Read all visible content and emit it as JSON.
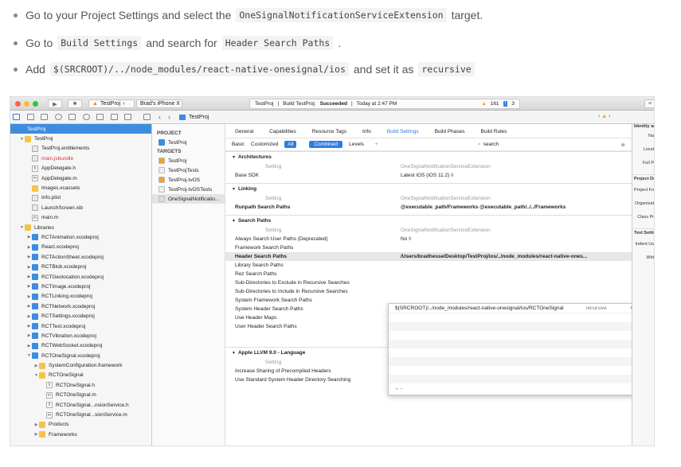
{
  "steps": [
    {
      "pre": "Go to your Project Settings and select the",
      "code": "OneSignalNotificationServiceExtension",
      "post": "target."
    },
    {
      "pre": "Go to",
      "code": "Build Settings",
      "mid": "and search for",
      "code2": "Header Search Paths",
      "post": "."
    },
    {
      "pre": "Add",
      "code": "$(SRCROOT)/../node_modules/react-native-onesignal/ios",
      "mid": "and set it as",
      "code2": "recursive",
      "post": ""
    }
  ],
  "xcode": {
    "scheme_target": "TestProj",
    "device": "Brad's iPhone X",
    "status_project": "TestProj",
    "status_prefix": "Build TestProj:",
    "status_result": "Succeeded",
    "status_time": "Today at 2:47 PM",
    "warnings": "161",
    "errors": "3",
    "breadcrumb": "TestProj",
    "navigator": [
      {
        "label": "TestProj",
        "indent": 0,
        "icon": "proj",
        "open": true,
        "selected": true
      },
      {
        "label": "TestProj",
        "indent": 1,
        "icon": "folder",
        "open": true
      },
      {
        "label": "TestProj.entitlements",
        "indent": 2,
        "icon": "file"
      },
      {
        "label": "main.jsbundle",
        "indent": 2,
        "icon": "file",
        "red": true
      },
      {
        "label": "AppDelegate.h",
        "indent": 2,
        "icon": "h"
      },
      {
        "label": "AppDelegate.m",
        "indent": 2,
        "icon": "m"
      },
      {
        "label": "Images.xcassets",
        "indent": 2,
        "icon": "folder"
      },
      {
        "label": "Info.plist",
        "indent": 2,
        "icon": "file"
      },
      {
        "label": "LaunchScreen.xib",
        "indent": 2,
        "icon": "file"
      },
      {
        "label": "main.m",
        "indent": 2,
        "icon": "m"
      },
      {
        "label": "Libraries",
        "indent": 1,
        "icon": "folder",
        "open": true
      },
      {
        "label": "RCTAnimation.xcodeproj",
        "indent": 2,
        "icon": "proj",
        "closed": true
      },
      {
        "label": "React.xcodeproj",
        "indent": 2,
        "icon": "proj",
        "closed": true
      },
      {
        "label": "RCTActionSheet.xcodeproj",
        "indent": 2,
        "icon": "proj",
        "closed": true
      },
      {
        "label": "RCTBlob.xcodeproj",
        "indent": 2,
        "icon": "proj",
        "closed": true
      },
      {
        "label": "RCTGeolocation.xcodeproj",
        "indent": 2,
        "icon": "proj",
        "closed": true
      },
      {
        "label": "RCTImage.xcodeproj",
        "indent": 2,
        "icon": "proj",
        "closed": true
      },
      {
        "label": "RCTLinking.xcodeproj",
        "indent": 2,
        "icon": "proj",
        "closed": true
      },
      {
        "label": "RCTNetwork.xcodeproj",
        "indent": 2,
        "icon": "proj",
        "closed": true
      },
      {
        "label": "RCTSettings.xcodeproj",
        "indent": 2,
        "icon": "proj",
        "closed": true
      },
      {
        "label": "RCTText.xcodeproj",
        "indent": 2,
        "icon": "proj",
        "closed": true
      },
      {
        "label": "RCTVibration.xcodeproj",
        "indent": 2,
        "icon": "proj",
        "closed": true
      },
      {
        "label": "RCTWebSocket.xcodeproj",
        "indent": 2,
        "icon": "proj",
        "closed": true
      },
      {
        "label": "RCTOneSignal.xcodeproj",
        "indent": 2,
        "icon": "proj",
        "open": true
      },
      {
        "label": "SystemConfiguration.framework",
        "indent": 3,
        "icon": "folder",
        "closed": true
      },
      {
        "label": "RCTOneSignal",
        "indent": 3,
        "icon": "folder",
        "open": true
      },
      {
        "label": "RCTOneSignal.h",
        "indent": 4,
        "icon": "h"
      },
      {
        "label": "RCTOneSignal.m",
        "indent": 4,
        "icon": "m"
      },
      {
        "label": "RCTOneSignal...nsionService.h",
        "indent": 4,
        "icon": "h"
      },
      {
        "label": "RCTOneSignal...sionService.m",
        "indent": 4,
        "icon": "m"
      },
      {
        "label": "Products",
        "indent": 3,
        "icon": "folder",
        "closed": true
      },
      {
        "label": "Frameworks",
        "indent": 3,
        "icon": "folder",
        "closed": true
      }
    ],
    "project_label": "PROJECT",
    "project_item": "TestProj",
    "targets_label": "TARGETS",
    "targets": [
      "TestProj",
      "TestProjTests",
      "TestProj-tvOS",
      "TestProj-tvOSTests",
      "OneSignalNotificatio..."
    ],
    "tabs": [
      "General",
      "Capabilities",
      "Resource Tags",
      "Info",
      "Build Settings",
      "Build Phases",
      "Build Rules"
    ],
    "active_tab": "Build Settings",
    "filters": [
      "Basic",
      "Customized",
      "All",
      "Combined",
      "Levels"
    ],
    "search_value": "search",
    "sections": [
      {
        "title": "Architectures",
        "header": {
          "k": "Setting",
          "v": "OneSignalNotificationServiceExtension"
        },
        "rows": [
          {
            "k": "Base SDK",
            "v": "Latest iOS (iOS 11.2) ◊"
          }
        ]
      },
      {
        "title": "Linking",
        "header": {
          "k": "Setting",
          "v": "OneSignalNotificationServiceExtension"
        },
        "rows": [
          {
            "k": "Runpath Search Paths",
            "v": "@executable_path/Frameworks @executable_path/../../Frameworks",
            "bold": true
          }
        ]
      },
      {
        "title": "Search Paths",
        "header": {
          "k": "Setting",
          "v": "OneSignalNotificationServiceExtension"
        },
        "rows": [
          {
            "k": "Always Search User Paths (Deprecated)",
            "v": "No ◊"
          },
          {
            "k": "Framework Search Paths",
            "v": ""
          },
          {
            "k": "Header Search Paths",
            "v": "/Users/bradhesse/Desktop/TestProj/ios/../node_modules/react-native-ones...",
            "bold": true,
            "hl": true
          },
          {
            "k": "Library Search Paths",
            "v": ""
          },
          {
            "k": "Rez Search Paths",
            "v": ""
          },
          {
            "k": "Sub-Directories to Exclude in Recursive Searches",
            "v": ""
          },
          {
            "k": "Sub-Directories to Include in Recursive Searches",
            "v": ""
          },
          {
            "k": "System Framework Search Paths",
            "v": ""
          },
          {
            "k": "System Header Search Paths",
            "v": ""
          },
          {
            "k": "Use Header Maps",
            "v": ""
          },
          {
            "k": "User Header Search Paths",
            "v": ""
          }
        ]
      },
      {
        "title": "Apple LLVM 9.0 - Language",
        "header": {
          "k": "Setting",
          "v": ""
        },
        "rows": [
          {
            "k": "Increase Sharing of Precompiled Headers",
            "v": ""
          },
          {
            "k": "Use Standard System Header Directory Searching",
            "v": ""
          }
        ]
      }
    ],
    "popup_path": "$(SRCROOT)/../node_modules/react-native-onesignal/ios/RCTOneSignal",
    "popup_mode": "recursive",
    "popup_controls": "+ −",
    "inspector": [
      "Identity and",
      "Na",
      "Locat",
      "Full P",
      "Project Doc",
      "Project Forr",
      "Organizat",
      "Class Pr",
      "Text Setting",
      "Indent Us",
      "Wid"
    ]
  }
}
